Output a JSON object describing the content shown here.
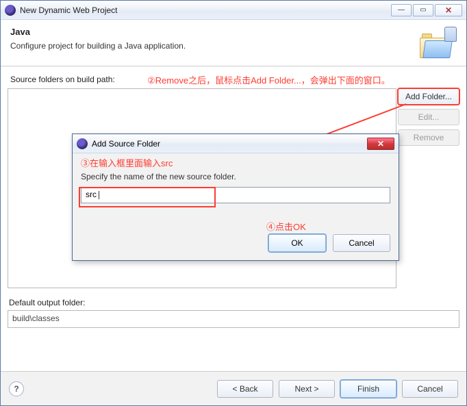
{
  "window": {
    "title": "New Dynamic Web Project"
  },
  "header": {
    "title": "Java",
    "subtitle": "Configure project for building a Java application."
  },
  "labels": {
    "source_folders": "Source folders on build path:",
    "default_output": "Default output folder:"
  },
  "buttons": {
    "add_folder": "Add Folder...",
    "edit": "Edit...",
    "remove": "Remove",
    "back": "< Back",
    "next": "Next >",
    "finish": "Finish",
    "cancel": "Cancel",
    "ok": "OK",
    "help": "?"
  },
  "output_folder_value": "build\\classes",
  "dialog": {
    "title": "Add Source Folder",
    "subtitle": "Specify the name of the new source folder.",
    "input_value": "src"
  },
  "annotations": {
    "a2_num": "②",
    "a2_text": "Remove之后，鼠标点击Add Folder...，会弹出下面的窗口。",
    "a3_num": "③",
    "a3_text": "在输入框里面输入src",
    "a4_num": "④",
    "a4_text": "点击OK"
  }
}
